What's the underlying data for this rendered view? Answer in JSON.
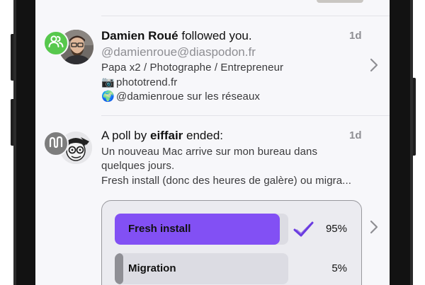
{
  "notifications": [
    {
      "type": "follow",
      "actor": "Damien Roué",
      "action": " followed you.",
      "time": "1d",
      "handle": "@damienroue@diaspodon.fr",
      "bio": [
        {
          "emoji": "",
          "text": "Papa x2 / Photographe / Entrepreneur"
        },
        {
          "emoji": "📷",
          "text": "phototrend.fr"
        },
        {
          "emoji": "🌍",
          "text": "@damienroue sur les réseaux"
        }
      ],
      "badge_icon": "people-icon",
      "badge_color": "#57c84d"
    },
    {
      "type": "poll",
      "prefix": "A poll by ",
      "actor": "eiffair",
      "action": " ended:",
      "time": "1d",
      "content": [
        "Un nouveau Mac arrive sur mon bureau dans",
        "quelques jours.",
        "Fresh install (donc des heures de galère) ou migra..."
      ],
      "badge_icon": "poll-icon",
      "badge_color": "#7d7d7d",
      "poll": {
        "options": [
          {
            "label": "Fresh install",
            "percent": "95%",
            "value": 0.95,
            "winner": true
          },
          {
            "label": "Migration",
            "percent": "5%",
            "value": 0.05,
            "winner": false
          }
        ],
        "accent": "#8250f4"
      }
    }
  ]
}
